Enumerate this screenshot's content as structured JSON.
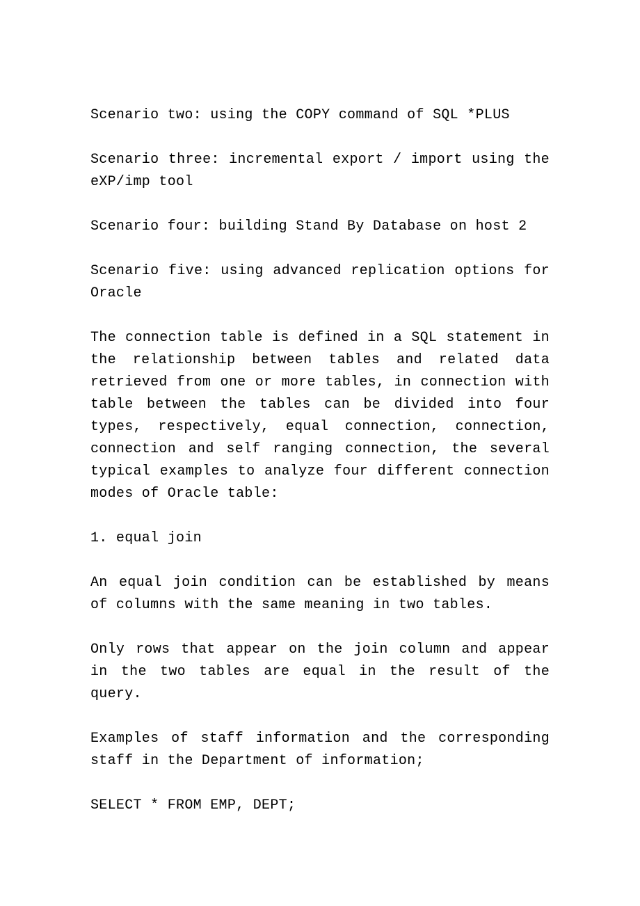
{
  "document": {
    "paragraphs": [
      "Scenario two: using the COPY command of SQL *PLUS",
      "Scenario three: incremental export / import using the eXP/imp tool",
      "Scenario four: building Stand By Database on host 2",
      "Scenario five: using advanced replication options for Oracle",
      "The connection table is defined in a SQL statement in the relationship between tables and related data retrieved from one or more tables, in connection with table between the tables can be divided into four types, respectively, equal connection, connection, connection and self ranging connection, the several typical examples to analyze four different connection modes of Oracle table:",
      "1. equal join",
      "An equal join condition can be established by means of columns with the same meaning in two tables.",
      "Only rows that appear on the join column and appear in the two tables are equal in the result of the query.",
      "Examples of staff information and the corresponding staff in the Department of information;",
      "SELECT * FROM EMP, DEPT;"
    ]
  }
}
